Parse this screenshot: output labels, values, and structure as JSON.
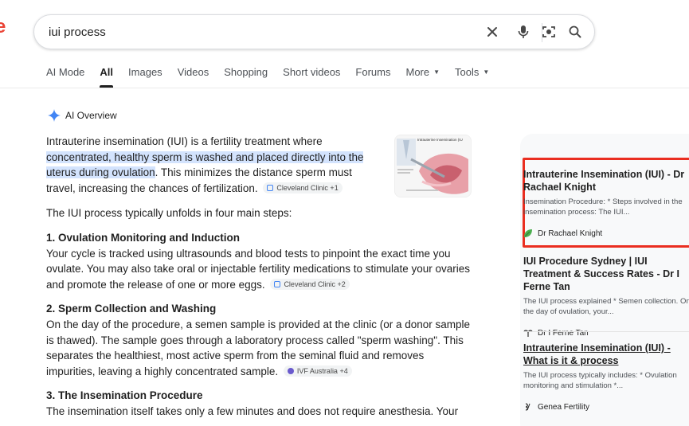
{
  "search": {
    "query": "iui process"
  },
  "tabs": [
    {
      "label": "AI Mode"
    },
    {
      "label": "All"
    },
    {
      "label": "Images"
    },
    {
      "label": "Videos"
    },
    {
      "label": "Shopping"
    },
    {
      "label": "Short videos"
    },
    {
      "label": "Forums"
    },
    {
      "label": "More"
    },
    {
      "label": "Tools"
    }
  ],
  "ai_overview": {
    "title": "AI Overview",
    "intro_before": "Intrauterine insemination (IUI) is a fertility treatment where ",
    "intro_highlight": "concentrated, healthy sperm is washed and placed directly into the uterus during ovulation",
    "intro_after": ". This minimizes the distance sperm must travel, increasing the chances of fertilization.",
    "intro_chip": "Cleveland Clinic +1",
    "thumb_title": "Intrauterine Insemination (IU",
    "steps_intro": "The IUI process typically unfolds in four main steps:",
    "steps": [
      {
        "heading": "1. Ovulation Monitoring and Induction",
        "text": "Your cycle is tracked using ultrasounds and blood tests to pinpoint the exact time you ovulate. You may also take oral or injectable fertility medications to stimulate your ovaries and promote the release of one or more eggs.",
        "chip": "Cleveland Clinic +2"
      },
      {
        "heading": "2. Sperm Collection and Washing",
        "text": "On the day of the procedure, a semen sample is provided at the clinic (or a donor sample is thawed). The sample goes through a laboratory process called \"sperm washing\". This separates the healthiest, most active sperm from the seminal fluid and removes impurities, leaving a highly concentrated sample.",
        "chip": "IVF Australia +4"
      },
      {
        "heading": "3. The Insemination Procedure",
        "text": "The insemination itself takes only a few minutes and does not require anesthesia. Your"
      }
    ]
  },
  "sources": [
    {
      "title": "Intrauterine Insemination (IUI) - Dr Rachael Knight",
      "snippet": "Insemination Procedure: * Steps involved in the insemination process: The IUI...",
      "source": "Dr Rachael Knight"
    },
    {
      "title": "IUI Procedure Sydney | IUI Treatment & Success Rates - Dr I Ferne Tan",
      "snippet": "The IUI process explained * Semen collection. On the day of ovulation, your...",
      "source": "Dr I Ferne Tan"
    },
    {
      "title": "Intrauterine Insemination (IUI) - What is it & process",
      "snippet": "The IUI process typically includes: * Ovulation monitoring and stimulation *...",
      "source": "Genea Fertility"
    }
  ],
  "colors": {
    "highlight": "#d3e3fd",
    "accent_red": "#ea2e20",
    "ai_star": "#4285f4"
  }
}
